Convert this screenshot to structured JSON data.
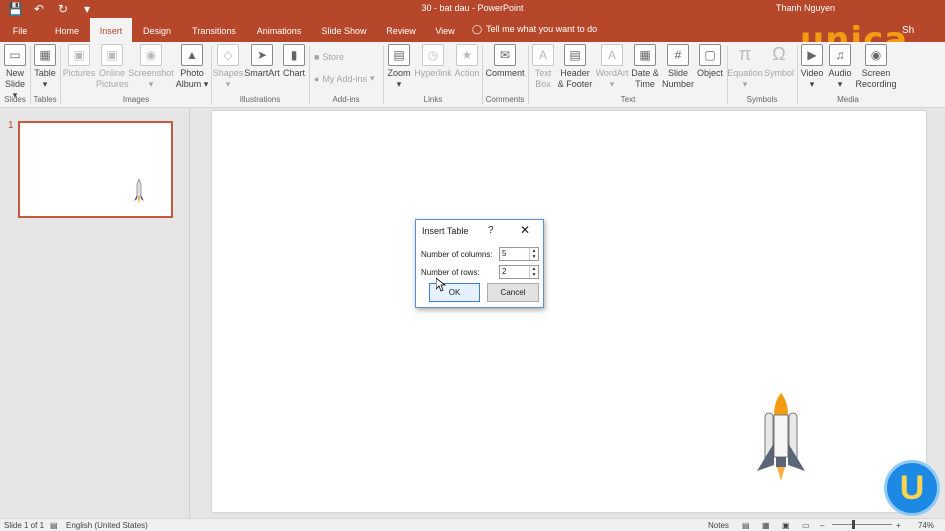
{
  "window": {
    "title": "30 - bat dau  -  PowerPoint",
    "user": "Thanh Nguyen",
    "share": "Sh"
  },
  "qat": {
    "save_icon": "💾",
    "undo_icon": "↶",
    "redo_icon": "↻",
    "customize_icon": "▾"
  },
  "tabs": [
    {
      "label": "File"
    },
    {
      "label": "Home"
    },
    {
      "label": "Insert"
    },
    {
      "label": "Design"
    },
    {
      "label": "Transitions"
    },
    {
      "label": "Animations"
    },
    {
      "label": "Slide Show"
    },
    {
      "label": "Review"
    },
    {
      "label": "View"
    }
  ],
  "tellme": "Tell me what you want to do",
  "ribbon": {
    "new_slide": "New\nSlide ▾",
    "table": "Table\n▾",
    "pictures": "Pictures",
    "online_pictures": "Online\nPictures",
    "screenshot": "Screenshot\n▾",
    "photo_album": "Photo\nAlbum ▾",
    "shapes": "Shapes\n▾",
    "smartart": "SmartArt",
    "chart": "Chart",
    "store": "Store",
    "my_addins": "My Add-ins",
    "zoom": "Zoom\n▾",
    "hyperlink": "Hyperlink",
    "action": "Action",
    "comment": "Comment",
    "text_box": "Text\nBox",
    "header_footer": "Header\n& Footer",
    "wordart": "WordArt\n▾",
    "date_time": "Date &\nTime",
    "slide_number": "Slide\nNumber",
    "object": "Object",
    "equation": "Equation\n▾",
    "symbol": "Symbol",
    "video": "Video\n▾",
    "audio": "Audio\n▾",
    "screen_recording": "Screen\nRecording",
    "groups": {
      "slides": "Slides",
      "tables": "Tables",
      "images": "Images",
      "illustrations": "Illustrations",
      "addins": "Add-ins",
      "links": "Links",
      "comments": "Comments",
      "text": "Text",
      "symbols": "Symbols",
      "media": "Media"
    }
  },
  "slides_pane": {
    "slide_number": "1"
  },
  "dialog": {
    "title": "Insert Table",
    "help": "?",
    "close": "✕",
    "columns_label": "Number of columns:",
    "columns_value": "5",
    "rows_label": "Number of rows:",
    "rows_value": "2",
    "ok": "OK",
    "cancel": "Cancel"
  },
  "status": {
    "slide_info": "Slide 1 of 1",
    "language": "English (United States)",
    "notes": "Notes",
    "zoom": "74%"
  },
  "watermark": {
    "logo": "unica",
    "badge": "U"
  },
  "colors": {
    "accent": "#b7472a",
    "ribbon": "#f3f3f3",
    "dialog_border": "#5b8fd6"
  }
}
